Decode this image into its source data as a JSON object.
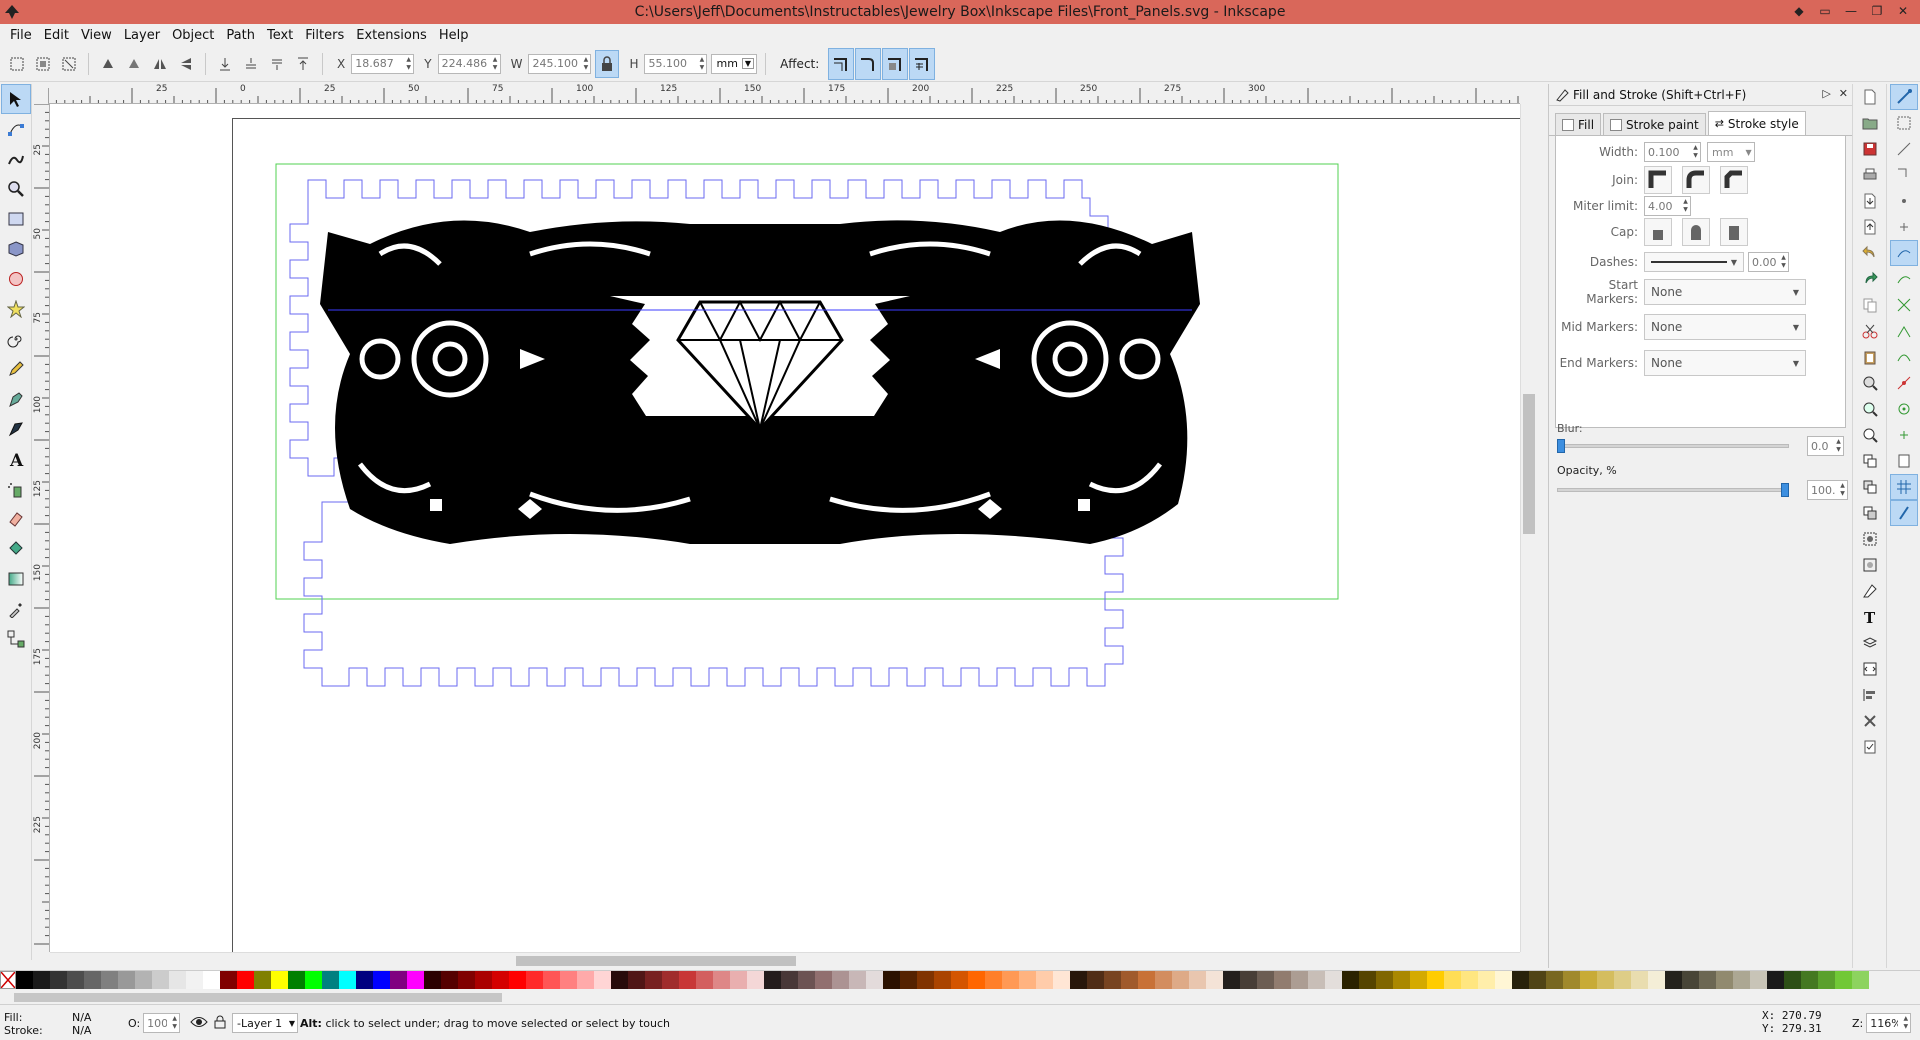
{
  "window": {
    "title": "C:\\Users\\Jeff\\Documents\\Instructables\\Jewelry Box\\Inkscape Files\\Front_Panels.svg - Inkscape",
    "buttons": [
      "◆",
      "▭",
      "—",
      "❐",
      "✕"
    ]
  },
  "menu": [
    "File",
    "Edit",
    "View",
    "Layer",
    "Object",
    "Path",
    "Text",
    "Filters",
    "Extensions",
    "Help"
  ],
  "toolcontrols": {
    "x_label": "X",
    "x_value": "18.687",
    "y_label": "Y",
    "y_value": "224.486",
    "w_label": "W",
    "w_value": "245.100",
    "h_label": "H",
    "h_value": "55.100",
    "unit": "mm",
    "affect_label": "Affect:"
  },
  "rulers": {
    "h_ticks": [
      "25",
      "0",
      "25",
      "50",
      "75",
      "100",
      "125",
      "150",
      "175",
      "200",
      "225",
      "250",
      "275",
      "300"
    ],
    "v_ticks": [
      "25",
      "50",
      "75",
      "100",
      "125",
      "150",
      "175",
      "200",
      "225"
    ]
  },
  "dock": {
    "title": "Fill and Stroke (Shift+Ctrl+F)",
    "tabs": [
      "Fill",
      "Stroke paint",
      "Stroke style"
    ],
    "width_label": "Width:",
    "width_value": "0.100",
    "width_unit": "mm",
    "join_label": "Join:",
    "miter_label": "Miter limit:",
    "miter_value": "4.00",
    "cap_label": "Cap:",
    "dashes_label": "Dashes:",
    "dashes_value": "0.00",
    "start_markers_label": "Start Markers:",
    "start_markers_value": "None",
    "mid_markers_label": "Mid Markers:",
    "mid_markers_value": "None",
    "end_markers_label": "End Markers:",
    "end_markers_value": "None",
    "blur_label": "Blur:",
    "blur_value": "0.0",
    "blur_fraction": 0.0,
    "opacity_label": "Opacity, %",
    "opacity_value": "100.0",
    "opacity_fraction": 1.0
  },
  "status": {
    "fill_label": "Fill:",
    "fill_value": "N/A",
    "stroke_label": "Stroke:",
    "stroke_value": "N/A",
    "opacity_label": "O:",
    "opacity_value": "100",
    "layer": "-Layer 1",
    "message_bold": "Alt:",
    "message": " click to select under; drag to move selected or select by touch",
    "x_label": "X:",
    "x_value": "270.79",
    "y_label": "Y:",
    "y_value": "279.31",
    "zoom_label": "Z:",
    "zoom_value": "116%"
  },
  "colors": {
    "titlebar": "#d9675a",
    "selection_green": "#50d050",
    "path_blue": "#6a6af0",
    "active_blue": "#bcd9f5"
  },
  "palette": [
    "#000000",
    "#1a1a1a",
    "#333333",
    "#4d4d4d",
    "#666666",
    "#808080",
    "#999999",
    "#b3b3b3",
    "#cccccc",
    "#e6e6e6",
    "#f2f2f2",
    "#ffffff",
    "#800000",
    "#ff0000",
    "#808000",
    "#ffff00",
    "#008000",
    "#00ff00",
    "#008080",
    "#00ffff",
    "#000080",
    "#0000ff",
    "#800080",
    "#ff00ff",
    "#2b0000",
    "#550000",
    "#800000",
    "#aa0000",
    "#d40000",
    "#ff0000",
    "#ff2a2a",
    "#ff5555",
    "#ff8080",
    "#ffaaaa",
    "#ffd5d5",
    "#280b0b",
    "#501616",
    "#782121",
    "#a02c2c",
    "#c83737",
    "#d35f5f",
    "#de8787",
    "#e9afaf",
    "#f4d7d7",
    "#241c1c",
    "#483737",
    "#6c5353",
    "#916f6f",
    "#ac9393",
    "#c8b7b7",
    "#e3dbdb",
    "#2b1100",
    "#552200",
    "#803300",
    "#aa4400",
    "#d45500",
    "#ff6600",
    "#ff7f2a",
    "#ff9955",
    "#ffb380",
    "#ffccaa",
    "#ffe6d5",
    "#28170b",
    "#502d16",
    "#784421",
    "#a05a2c",
    "#c87137",
    "#d38d5f",
    "#deaa87",
    "#e9c6af",
    "#f4e3d7",
    "#241f1c",
    "#483e37",
    "#6c5d53",
    "#917c6f",
    "#ac9d93",
    "#c8beb7",
    "#e3dedb",
    "#2b2200",
    "#554400",
    "#806600",
    "#aa8800",
    "#d4aa00",
    "#ffcc00",
    "#ffdd55",
    "#ffe680",
    "#ffeeaa",
    "#fff6d5",
    "#28220b",
    "#504416",
    "#786721",
    "#a0892c",
    "#c8ab37",
    "#d4bd5f",
    "#decd87",
    "#e9ddaf",
    "#f4eed7",
    "#24221c",
    "#484537",
    "#6c6753",
    "#918a6f",
    "#aca793",
    "#c8c4b7",
    "#1a1a1a",
    "#2d5016",
    "#447821",
    "#5aa02c",
    "#71c837",
    "#8dd35f"
  ]
}
